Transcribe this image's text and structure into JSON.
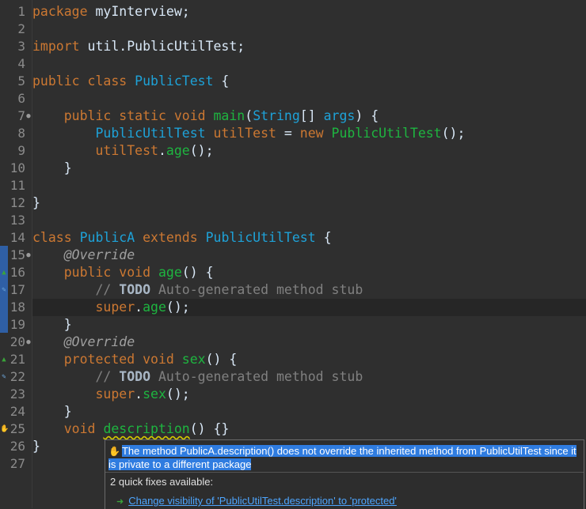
{
  "editor": {
    "lines": [
      {
        "n": "1",
        "tokens": [
          {
            "t": "package",
            "c": "k"
          },
          {
            "t": " myInterview;",
            "c": "p"
          }
        ]
      },
      {
        "n": "2",
        "tokens": []
      },
      {
        "n": "3",
        "tokens": [
          {
            "t": "import",
            "c": "k"
          },
          {
            "t": " util.PublicUtilTest;",
            "c": "p"
          }
        ]
      },
      {
        "n": "4",
        "tokens": []
      },
      {
        "n": "5",
        "tokens": [
          {
            "t": "public class",
            "c": "k"
          },
          {
            "t": " ",
            "c": "p"
          },
          {
            "t": "PublicTest",
            "c": "t"
          },
          {
            "t": " {",
            "c": "p"
          }
        ]
      },
      {
        "n": "6",
        "tokens": []
      },
      {
        "n": "7",
        "tokens": [
          {
            "t": "    ",
            "c": "p"
          },
          {
            "t": "public static void",
            "c": "k"
          },
          {
            "t": " ",
            "c": "p"
          },
          {
            "t": "main",
            "c": "m"
          },
          {
            "t": "(",
            "c": "p"
          },
          {
            "t": "String",
            "c": "t"
          },
          {
            "t": "[] ",
            "c": "p"
          },
          {
            "t": "args",
            "c": "t"
          },
          {
            "t": ") {",
            "c": "p"
          }
        ]
      },
      {
        "n": "8",
        "tokens": [
          {
            "t": "        ",
            "c": "p"
          },
          {
            "t": "PublicUtilTest",
            "c": "t"
          },
          {
            "t": " ",
            "c": "p"
          },
          {
            "t": "utilTest",
            "c": "k"
          },
          {
            "t": " = ",
            "c": "p"
          },
          {
            "t": "new",
            "c": "k"
          },
          {
            "t": " ",
            "c": "p"
          },
          {
            "t": "PublicUtilTest",
            "c": "m"
          },
          {
            "t": "();",
            "c": "p"
          }
        ]
      },
      {
        "n": "9",
        "tokens": [
          {
            "t": "        ",
            "c": "p"
          },
          {
            "t": "utilTest",
            "c": "k"
          },
          {
            "t": ".",
            "c": "p"
          },
          {
            "t": "age",
            "c": "m"
          },
          {
            "t": "();",
            "c": "p"
          }
        ]
      },
      {
        "n": "10",
        "tokens": [
          {
            "t": "    }",
            "c": "p"
          }
        ]
      },
      {
        "n": "11",
        "tokens": []
      },
      {
        "n": "12",
        "tokens": [
          {
            "t": "}",
            "c": "p"
          }
        ]
      },
      {
        "n": "13",
        "tokens": []
      },
      {
        "n": "14",
        "tokens": [
          {
            "t": "class",
            "c": "k"
          },
          {
            "t": " ",
            "c": "p"
          },
          {
            "t": "PublicA",
            "c": "t"
          },
          {
            "t": " ",
            "c": "p"
          },
          {
            "t": "extends",
            "c": "k"
          },
          {
            "t": " ",
            "c": "p"
          },
          {
            "t": "PublicUtilTest",
            "c": "t"
          },
          {
            "t": " {",
            "c": "p"
          }
        ]
      },
      {
        "n": "15",
        "tokens": [
          {
            "t": "    ",
            "c": "p"
          },
          {
            "t": "@Override",
            "c": "a"
          }
        ]
      },
      {
        "n": "16",
        "tokens": [
          {
            "t": "    ",
            "c": "p"
          },
          {
            "t": "public void",
            "c": "k"
          },
          {
            "t": " ",
            "c": "p"
          },
          {
            "t": "age",
            "c": "m"
          },
          {
            "t": "() {",
            "c": "p"
          }
        ]
      },
      {
        "n": "17",
        "tokens": [
          {
            "t": "        ",
            "c": "p"
          },
          {
            "t": "// ",
            "c": "c"
          },
          {
            "t": "TODO",
            "c": "td"
          },
          {
            "t": " Auto-generated method stub",
            "c": "c"
          }
        ]
      },
      {
        "n": "18",
        "tokens": [
          {
            "t": "        ",
            "c": "p"
          },
          {
            "t": "super",
            "c": "k"
          },
          {
            "t": ".",
            "c": "p"
          },
          {
            "t": "age",
            "c": "m"
          },
          {
            "t": "();",
            "c": "p"
          }
        ]
      },
      {
        "n": "19",
        "tokens": [
          {
            "t": "    }",
            "c": "p"
          }
        ]
      },
      {
        "n": "20",
        "tokens": [
          {
            "t": "    ",
            "c": "p"
          },
          {
            "t": "@Override",
            "c": "a"
          }
        ]
      },
      {
        "n": "21",
        "tokens": [
          {
            "t": "    ",
            "c": "p"
          },
          {
            "t": "protected void",
            "c": "k"
          },
          {
            "t": " ",
            "c": "p"
          },
          {
            "t": "sex",
            "c": "m"
          },
          {
            "t": "() {",
            "c": "p"
          }
        ]
      },
      {
        "n": "22",
        "tokens": [
          {
            "t": "        ",
            "c": "p"
          },
          {
            "t": "// ",
            "c": "c"
          },
          {
            "t": "TODO",
            "c": "td"
          },
          {
            "t": " Auto-generated method stub",
            "c": "c"
          }
        ]
      },
      {
        "n": "23",
        "tokens": [
          {
            "t": "        ",
            "c": "p"
          },
          {
            "t": "super",
            "c": "k"
          },
          {
            "t": ".",
            "c": "p"
          },
          {
            "t": "sex",
            "c": "m"
          },
          {
            "t": "();",
            "c": "p"
          }
        ]
      },
      {
        "n": "24",
        "tokens": [
          {
            "t": "    }",
            "c": "p"
          }
        ]
      },
      {
        "n": "25",
        "tokens": [
          {
            "t": "    ",
            "c": "p"
          },
          {
            "t": "void",
            "c": "k"
          },
          {
            "t": " ",
            "c": "p"
          },
          {
            "t": "description",
            "c": "m sq"
          },
          {
            "t": "() {}",
            "c": "p"
          }
        ]
      },
      {
        "n": "26",
        "tokens": [
          {
            "t": "}",
            "c": "p"
          }
        ]
      },
      {
        "n": "27",
        "tokens": []
      }
    ],
    "current_line": "18",
    "gutter_markers": [
      {
        "line": "7",
        "icon": "collapse-dot-icon",
        "glyph": "●",
        "color": "#9a9a9a"
      },
      {
        "line": "15",
        "icon": "collapse-dot-icon",
        "glyph": "●",
        "color": "#9a9a9a"
      },
      {
        "line": "16",
        "icon": "override-triangle-icon",
        "glyph": "▲",
        "color": "#3aa33a"
      },
      {
        "line": "17",
        "icon": "task-icon",
        "glyph": "✎",
        "color": "#6fa8dc"
      },
      {
        "line": "20",
        "icon": "collapse-dot-icon",
        "glyph": "●",
        "color": "#9a9a9a"
      },
      {
        "line": "21",
        "icon": "override-triangle-icon",
        "glyph": "▲",
        "color": "#3aa33a"
      },
      {
        "line": "22",
        "icon": "task-icon",
        "glyph": "✎",
        "color": "#6fa8dc"
      },
      {
        "line": "25",
        "icon": "warning-lightbulb-icon",
        "glyph": "✋",
        "color": "#e6c200"
      }
    ]
  },
  "hover": {
    "message": "The method PublicA.description() does not override the inherited method from PublicUtilTest since it is private to a different package",
    "quick_fix_count": "2 quick fixes available:",
    "fix_label": "Change visibility of 'PublicUtilTest.description' to 'protected'",
    "icons": {
      "message": "warning-icon",
      "fix": "quick-fix-arrow-icon"
    }
  },
  "colors": {
    "keyword": "#cc7832",
    "type": "#1ea2d8",
    "method": "#1eb540",
    "selection": "#2f7ce0",
    "link": "#4ea6ff"
  }
}
